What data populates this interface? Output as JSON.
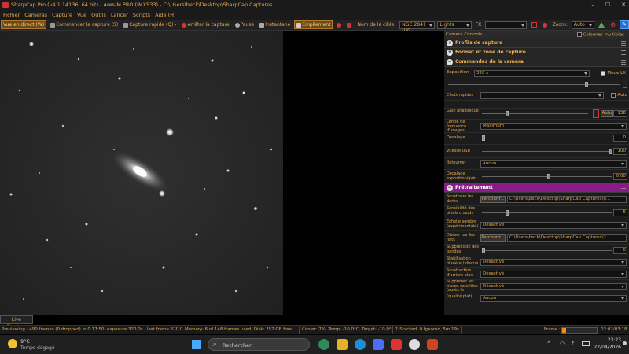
{
  "window": {
    "title": "SharpCap Pro (v4.1.14136, 64 bit) - Ares-M PRO (IMX533) - C:\\Users\\beck\\Desktop\\SharpCap Captures",
    "min_glyph": "–",
    "max_glyph": "☐",
    "close_glyph": "✕"
  },
  "menu": [
    "Fichier",
    "Caméras",
    "Capture",
    "Vue",
    "Outils",
    "Lancer",
    "Scripts",
    "Aide (H)"
  ],
  "toolbar": {
    "live_view": "Vue en direct (W)",
    "start_capture": "Commencer la capture (S)",
    "quick_capture": "Capture rapide (Q)",
    "stop_capture": "Arrêter la capture",
    "pause": "Pause",
    "snapshot": "Instantané",
    "stacking": "Empilement",
    "target_label": "Nom de la cible:",
    "target_value": "NGC 2841 (UG",
    "frame_type": "Lights",
    "fx_label": "FX",
    "zoom_label": "Zoom:",
    "zoom_value": "Auto"
  },
  "panel": {
    "header": "Camera Controls",
    "multi_columns": "Colonnes multiples",
    "sections": {
      "capture_profiles": "Profils de capture",
      "format": "Format et zone de capture",
      "camera_controls": "Commandes de la caméra",
      "preprocessing": "Prétraitement"
    },
    "exposure": {
      "label": "Exposition",
      "value": "320 s",
      "mode_lx": "Mode LX"
    },
    "quick_choices": {
      "label": "Choix rapides",
      "auto": "Auto"
    },
    "analog_gain": {
      "label": "Gain analogique",
      "auto": "Auto",
      "value": "138"
    },
    "frame_rate_limit": {
      "label": "Limite de fréquence d'images",
      "value": "Maximum"
    },
    "offset": {
      "label": "Décalage",
      "value": "0"
    },
    "usb_speed": {
      "label": "Vitesse USB",
      "value": "100"
    },
    "flip": {
      "label": "Retourner",
      "value": "Aucun"
    },
    "exposure_gain_offset": {
      "label": "Décalage exposition/gain",
      "value": "0,00"
    },
    "subtract_darks": {
      "label": "Soustraire les darks",
      "browse": "Parcourir...",
      "path": "C:\\Users\\beck\\Desktop\\SharpCap Captures\\d..."
    },
    "hot_pixel": {
      "label": "Sensibilité des pixels chauds",
      "value": "5"
    },
    "dark_scaling": {
      "label": "Échelle sombre (expérimentale)",
      "value": "Désactivé"
    },
    "divide_flats": {
      "label": "Diviser par les flats",
      "browse": "Parcourir...",
      "path": "C:\\Users\\beck\\Desktop\\SharpCap Captures\\2..."
    },
    "banding_suppression": {
      "label": "Suppression des bandes",
      "value": "0"
    },
    "planet_stabilization": {
      "label": "Stabilisation planète / disque",
      "value": "Désactivé"
    },
    "background_subtraction": {
      "label": "Soustraction d'arrière plan",
      "value": "Désactivé"
    },
    "remove_satellite": {
      "label": "Supprimer les traces satellites (après la tombée de la nuit)",
      "value": "Désactivé"
    },
    "last": {
      "label": "(qualité plat)",
      "value": "Aucun"
    }
  },
  "live_stacking": "Live Stacking",
  "status": {
    "preview": "Previewing : 490 frames (0 dropped) in 0:17:50, exposure 320,0s , last frame 320,0s",
    "memory": "Memory: 6 of 148 frames used, Disk: 257 GB free",
    "cooler": "Cooler: 7%, Temp: -10,0°C, Target: -10,0°C",
    "stacked": "1 Stacked, 0 Ignored, 5m 19s",
    "frame_label": "Frame :",
    "frame_time": "02:02/03:18",
    "frame_progress": 0.12
  },
  "taskbar": {
    "weather_temp": "9°C",
    "weather_desc": "Temps dégagé",
    "search_placeholder": "Rechercher",
    "time": "23:23",
    "date": "22/04/2026"
  },
  "colors": {
    "accent": "#e6a94a",
    "preprocess": "#8a1c8a",
    "progress": "#f0901a"
  }
}
